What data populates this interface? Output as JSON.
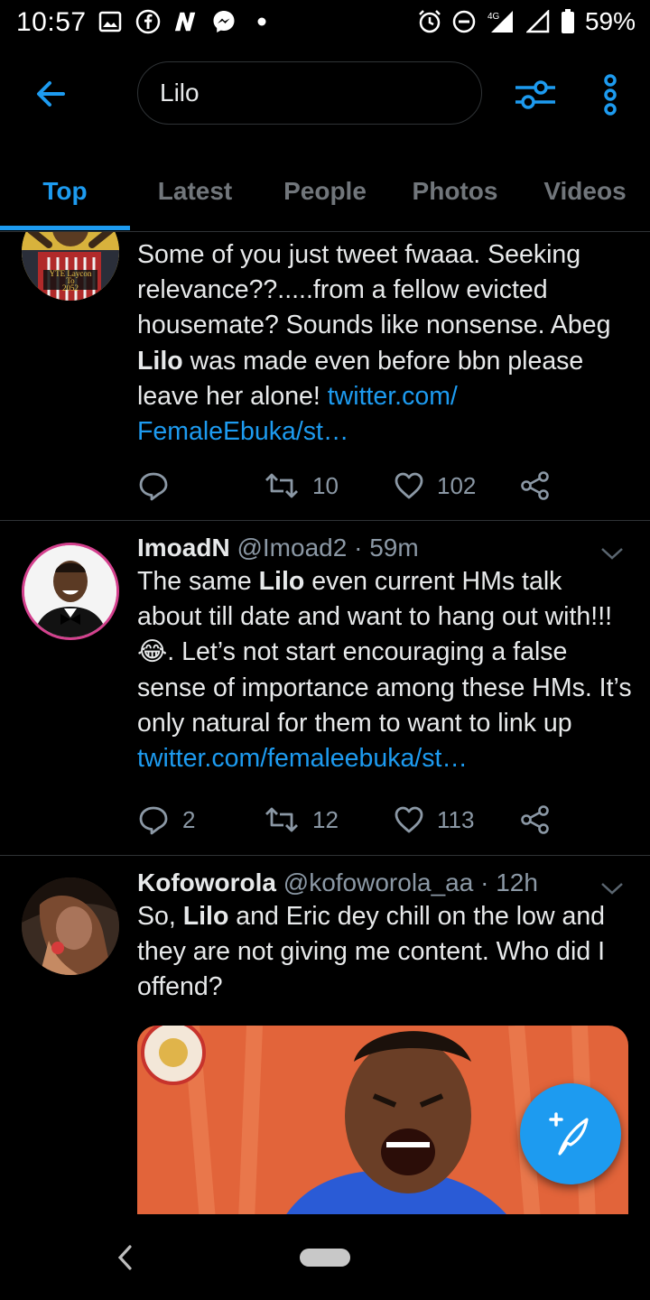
{
  "status_bar": {
    "time": "10:57",
    "battery": "59%",
    "network": "4G",
    "left_icons": [
      "gallery-icon",
      "facebook-icon",
      "n-app-icon",
      "messenger-icon",
      "dot-icon"
    ],
    "right_icons": [
      "alarm-icon",
      "dnd-icon",
      "signal-icon",
      "signal-icon",
      "battery-icon"
    ]
  },
  "header": {
    "search_value": "Lilo",
    "back_icon": "arrow-left-icon",
    "filter_icon": "sliders-icon",
    "more_icon": "more-vertical-icon"
  },
  "tabs": [
    {
      "label": "Top",
      "active": true
    },
    {
      "label": "Latest",
      "active": false
    },
    {
      "label": "People",
      "active": false
    },
    {
      "label": "Photos",
      "active": false
    },
    {
      "label": "Videos",
      "active": false
    }
  ],
  "tweets": [
    {
      "avatar_text_1": "YTE Laycon",
      "avatar_text_2": "To",
      "avatar_text_3": "2052",
      "text_1": "Some of you just tweet fwaaa. Seeking relevance??.....from a fellow evicted housemate? Sounds like nonsense. Abeg ",
      "highlight": "Lilo",
      "text_2": " was made even before bbn please leave her alone! ",
      "link_1": "twitter.com/",
      "link_2": "FemaleEbuka/st…",
      "reply_count": "",
      "retweet_count": "10",
      "like_count": "102"
    },
    {
      "name": "ImoadN",
      "handle": "@Imoad2",
      "dot": "·",
      "time": "59m",
      "text_1": "The same ",
      "highlight": "Lilo",
      "text_2": " even current HMs talk about till date and want to hang out with!!! 😂. Let’s not start encouraging a false sense of importance among these HMs. It’s only natural for them to want to link up ",
      "link": "twitter.com/femaleebuka/st…",
      "reply_count": "2",
      "retweet_count": "12",
      "like_count": "113"
    },
    {
      "name": "Kofoworola",
      "handle": "@kofoworola_aa",
      "dot": "·",
      "time": "12h",
      "text_1": "So, ",
      "highlight": "Lilo",
      "text_2": " and Eric dey chill on the low and they are not giving me content. Who did I offend?"
    }
  ],
  "fab": {
    "icon": "compose-feather-icon"
  },
  "nav_bar": {
    "back_icon": "nav-back-icon",
    "home_icon": "home-pill-icon"
  },
  "colors": {
    "accent": "#1d9bf0",
    "background": "#000000",
    "muted": "#8b98a5",
    "divider": "#2f3336"
  }
}
